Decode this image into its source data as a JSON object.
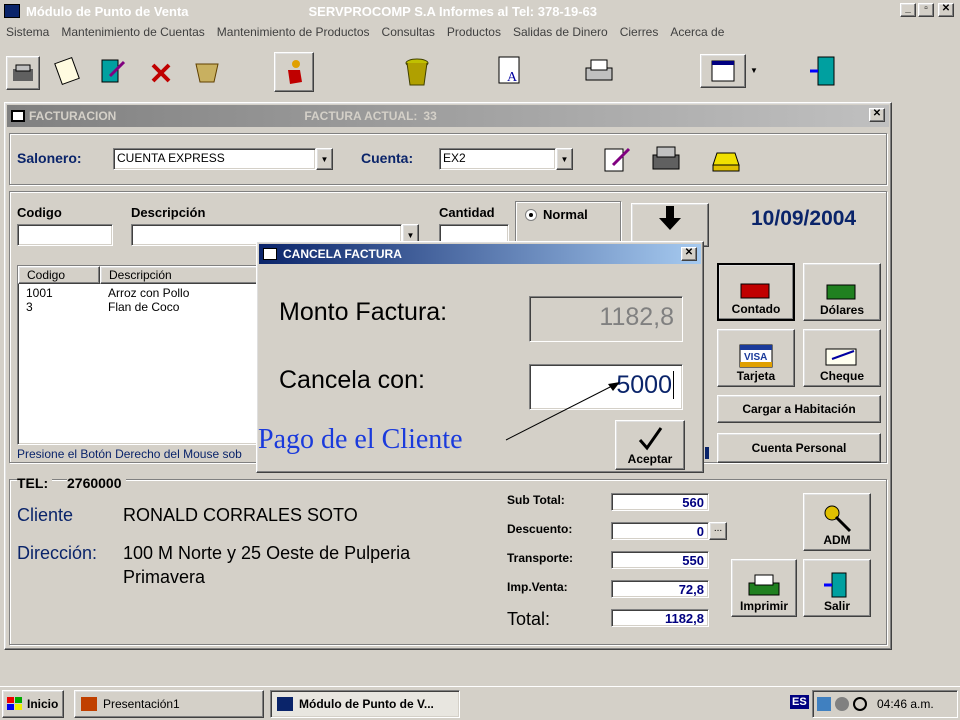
{
  "app": {
    "title": "Módulo de Punto de Venta",
    "company": "SERVPROCOMP S.A  Informes al Tel:  378-19-63",
    "menu": [
      "Sistema",
      "Mantenimiento de Cuentas",
      "Mantenimiento de Productos",
      "Consultas",
      "Productos",
      "Salidas de Dinero",
      "Cierres",
      "Acerca de"
    ],
    "toolbar_icons": [
      "cash-register-icon",
      "notebook-icon",
      "edit-document-icon",
      "delete-x-icon",
      "basket-icon",
      "runner-icon",
      "trash-bin-icon",
      "user-document-icon",
      "printer-icon",
      "calculator-window-icon",
      "exit-door-icon"
    ]
  },
  "factura": {
    "title": "FACTURACION",
    "current_label": "FACTURA ACTUAL:",
    "current_number": "33",
    "salonero_label": "Salonero:",
    "salonero_value": "CUENTA EXPRESS",
    "cuenta_label": "Cuenta:",
    "cuenta_value": "EX2",
    "codigo_label": "Codigo",
    "descripcion_label": "Descripción",
    "cantidad_label": "Cantidad",
    "radio_normal": "Normal",
    "date": "10/09/2004",
    "list_headers": [
      "Codigo",
      "Descripción"
    ],
    "list_rows": [
      {
        "codigo": "1001",
        "descripcion": "Arroz con Pollo"
      },
      {
        "codigo": "3",
        "descripcion": "Flan de Coco"
      }
    ],
    "hint": "Presione el Botón Derecho del Mouse sob",
    "buttons": {
      "contado": "Contado",
      "dolares": "Dólares",
      "tarjeta": "Tarjeta",
      "cheque": "Cheque",
      "habitacion": "Cargar a Habitación",
      "personal": "Cuenta Personal",
      "adm": "ADM",
      "imprimir": "Imprimir",
      "salir": "Salir"
    },
    "tel_label": "TEL:",
    "tel_value": "2760000",
    "cliente_label": "Cliente",
    "cliente_value": "RONALD CORRALES SOTO",
    "direccion_label": "Dirección:",
    "direccion_line1": "100 M Norte y 25 Oeste de Pulperia",
    "direccion_line2": "Primavera",
    "totals": {
      "subtotal_label": "Sub Total:",
      "subtotal": "560",
      "descuento_label": "Descuento:",
      "descuento": "0",
      "transporte_label": "Transporte:",
      "transporte": "550",
      "impventa_label": "Imp.Venta:",
      "impventa": "72,8",
      "total_label": "Total:",
      "total": "1182,8"
    }
  },
  "dialog": {
    "title": "CANCELA FACTURA",
    "monto_label": "Monto Factura:",
    "monto_value": "1182,8",
    "cancela_label": "Cancela con:",
    "cancela_value": "5000",
    "accept": "Aceptar"
  },
  "annotation": "Pago de el Cliente",
  "taskbar": {
    "start": "Inicio",
    "tasks": [
      "Presentación1",
      "Módulo de Punto de V..."
    ],
    "lang": "ES",
    "clock": "04:46 a.m."
  }
}
